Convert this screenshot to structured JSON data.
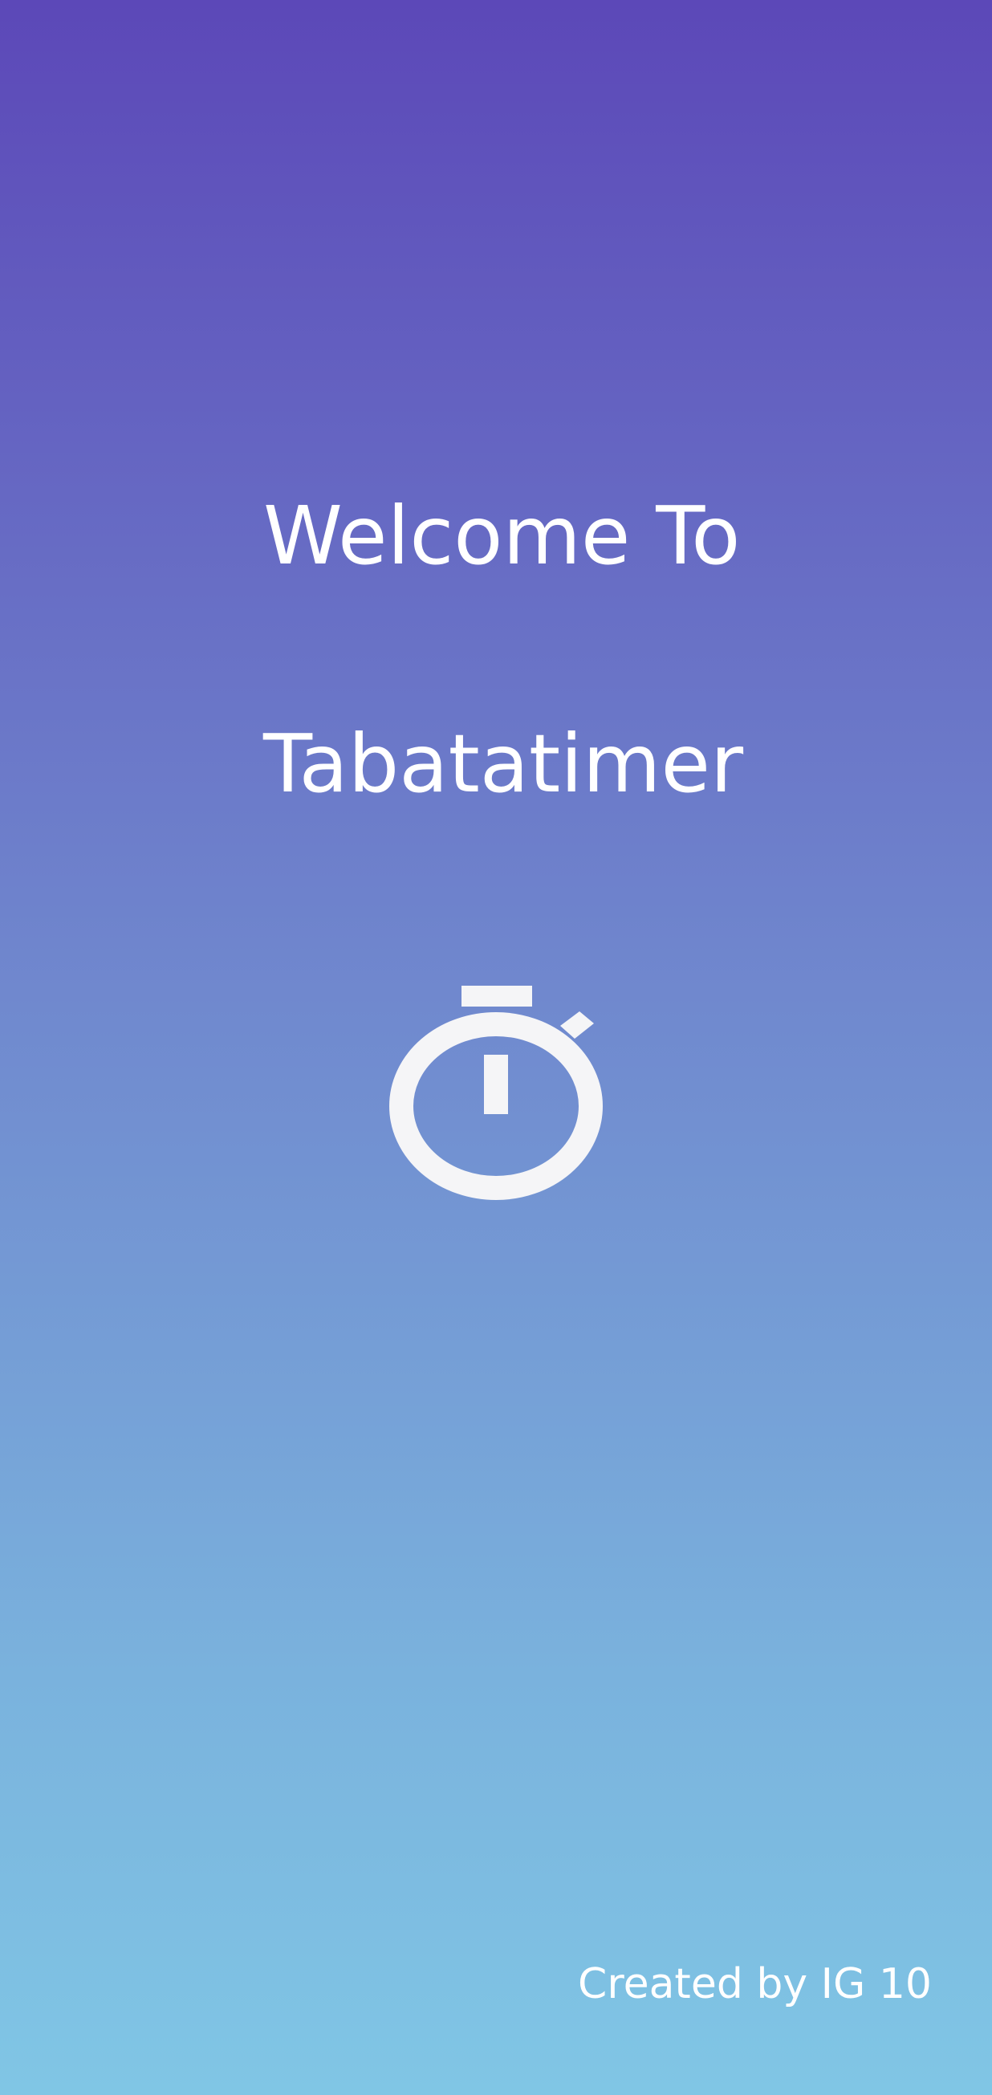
{
  "splash": {
    "title_line1": "Welcome To",
    "title_line2": "Tabatatimer",
    "icon": "stopwatch-icon",
    "credit": "Created by IG 10"
  },
  "colors": {
    "gradient_top": "#5c48b8",
    "gradient_bottom": "#80c6e5",
    "text": "#ffffff",
    "icon": "#f5f5f7"
  }
}
